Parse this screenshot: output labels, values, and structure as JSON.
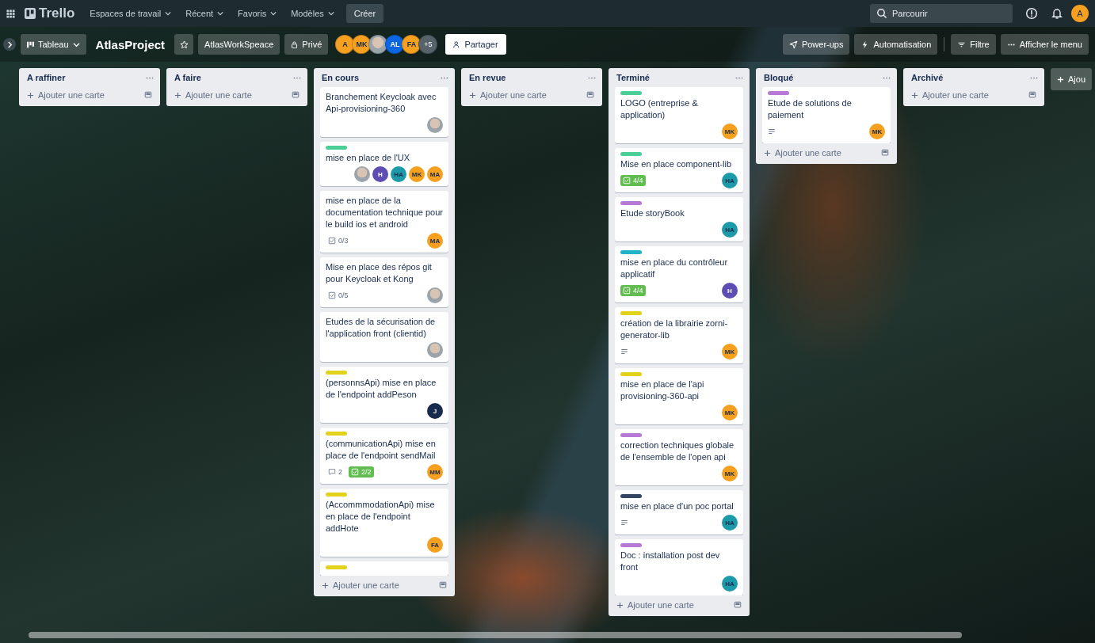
{
  "top_bar": {
    "logo": "Trello",
    "nav_items": [
      {
        "label": "Espaces de travail"
      },
      {
        "label": "Récent"
      },
      {
        "label": "Favoris"
      },
      {
        "label": "Modèles"
      }
    ],
    "create_button": "Créer",
    "search": {
      "placeholder": "Parcourir"
    },
    "user_avatar": {
      "initials": "A",
      "color": "#f6a020"
    }
  },
  "board_header": {
    "view_switcher": "Tableau",
    "title": "AtlasProject",
    "workspace": "AtlasWorkSpeace",
    "visibility": "Privé",
    "members": [
      {
        "kind": "initials",
        "initials": "A",
        "color": "#f6a020"
      },
      {
        "kind": "initials",
        "initials": "MK",
        "color": "#f6a020"
      },
      {
        "kind": "photo"
      },
      {
        "kind": "initials",
        "initials": "AL",
        "color": "#0c66e4"
      },
      {
        "kind": "initials",
        "initials": "FA",
        "color": "#f6a020"
      }
    ],
    "extra_members": "+5",
    "share_button": "Partager",
    "actions": [
      {
        "label": "Power-ups"
      },
      {
        "label": "Automatisation"
      },
      {
        "label": "Filtre"
      },
      {
        "label": "Afficher le menu"
      }
    ]
  },
  "lists": [
    {
      "title": "A raffiner",
      "add_card": "Ajouter une carte"
    },
    {
      "title": "A faire",
      "add_card": "Ajouter une carte"
    },
    {
      "title": "En cours",
      "add_card": "Ajouter une carte",
      "cards": [
        {
          "title": "Branchement Keycloak avec Api-provisioning-360",
          "members": [
            {
              "kind": "photo"
            }
          ]
        },
        {
          "labels": [
            {
              "color": "#4bce97"
            }
          ],
          "title": "mise en place de l'UX",
          "members": [
            {
              "kind": "photo"
            },
            {
              "kind": "initials",
              "initials": "H",
              "color": "#5e4db2"
            },
            {
              "kind": "initials",
              "initials": "HA",
              "color": "#1d9aaa"
            },
            {
              "kind": "initials",
              "initials": "MK",
              "color": "#f6a020"
            },
            {
              "kind": "initials",
              "initials": "MA",
              "color": "#f6a020"
            }
          ]
        },
        {
          "title": "mise en place de la documentation technique pour le build ios et android",
          "badges": [
            {
              "kind": "checklist",
              "text": "0/3",
              "complete": false
            }
          ],
          "members": [
            {
              "kind": "initials",
              "initials": "MA",
              "color": "#f6a020"
            }
          ]
        },
        {
          "title": "Mise en place des répos git pour Keycloak et Kong",
          "badges": [
            {
              "kind": "checklist",
              "text": "0/5",
              "complete": false
            }
          ],
          "members": [
            {
              "kind": "photo"
            }
          ]
        },
        {
          "title": "Etudes de la sécurisation de l'application front (clientid)",
          "members": [
            {
              "kind": "photo"
            }
          ]
        },
        {
          "labels": [
            {
              "color": "#e2d21a"
            }
          ],
          "title": "(personnsApi) mise en place de l'endpoint addPeson",
          "members": [
            {
              "kind": "initials",
              "initials": "J",
              "color": "#172b4d"
            }
          ]
        },
        {
          "labels": [
            {
              "color": "#e2d21a"
            }
          ],
          "title": "(communicationApi) mise en place de l'endpoint sendMail",
          "badges": [
            {
              "kind": "comments",
              "text": "2"
            },
            {
              "kind": "checklist",
              "text": "2/2",
              "complete": true
            }
          ],
          "members": [
            {
              "kind": "initials",
              "initials": "MM",
              "color": "#f6a020"
            }
          ]
        },
        {
          "labels": [
            {
              "color": "#e2d21a"
            }
          ],
          "title": "(AccommmodationApi) mise en place de l'endpoint addHote",
          "members": [
            {
              "kind": "initials",
              "initials": "FA",
              "color": "#f6a020"
            }
          ]
        },
        {
          "labels": [
            {
              "color": "#e2d21a"
            }
          ]
        }
      ]
    },
    {
      "title": "En revue",
      "add_card": "Ajouter une carte"
    },
    {
      "title": "Terminé",
      "add_card": "Ajouter une carte",
      "cards": [
        {
          "labels": [
            {
              "color": "#4bce97"
            }
          ],
          "title": "LOGO (entreprise & application)",
          "members": [
            {
              "kind": "initials",
              "initials": "MK",
              "color": "#f6a020"
            }
          ]
        },
        {
          "labels": [
            {
              "color": "#4bce97"
            }
          ],
          "title": "Mise en place component-lib",
          "badges": [
            {
              "kind": "checklist",
              "text": "4/4",
              "complete": true
            }
          ],
          "members": [
            {
              "kind": "initials",
              "initials": "HA",
              "color": "#1d9aaa"
            }
          ]
        },
        {
          "labels": [
            {
              "color": "#b67ad6"
            }
          ],
          "title": "Etude storyBook",
          "members": [
            {
              "kind": "initials",
              "initials": "HA",
              "color": "#1d9aaa"
            }
          ]
        },
        {
          "labels": [
            {
              "color": "#1fb3c8"
            }
          ],
          "title": "mise en place du contrôleur applicatif",
          "badges": [
            {
              "kind": "checklist",
              "text": "4/4",
              "complete": true
            }
          ],
          "members": [
            {
              "kind": "initials",
              "initials": "H",
              "color": "#5e4db2"
            }
          ]
        },
        {
          "labels": [
            {
              "color": "#e2d21a"
            }
          ],
          "title": "création de la librairie zorni-generator-lib",
          "badges": [
            {
              "kind": "description"
            }
          ],
          "members": [
            {
              "kind": "initials",
              "initials": "MK",
              "color": "#f6a020"
            }
          ]
        },
        {
          "labels": [
            {
              "color": "#e2d21a"
            }
          ],
          "title": "mise en place de l'api provisioning-360-api",
          "members": [
            {
              "kind": "initials",
              "initials": "MK",
              "color": "#f6a020"
            }
          ]
        },
        {
          "labels": [
            {
              "color": "#b67ad6"
            }
          ],
          "title": "correction techniques globale de l'ensemble de l'open api",
          "members": [
            {
              "kind": "initials",
              "initials": "MK",
              "color": "#f6a020"
            }
          ]
        },
        {
          "labels": [
            {
              "color": "#344563"
            }
          ],
          "title": "mise en place d'un poc portal",
          "badges": [
            {
              "kind": "description"
            }
          ],
          "members": [
            {
              "kind": "initials",
              "initials": "HA",
              "color": "#1d9aaa"
            }
          ]
        },
        {
          "labels": [
            {
              "color": "#b67ad6"
            }
          ],
          "title": "Doc : installation post dev front",
          "members": [
            {
              "kind": "initials",
              "initials": "HA",
              "color": "#1d9aaa"
            }
          ]
        }
      ]
    },
    {
      "title": "Bloqué",
      "add_card": "Ajouter une carte",
      "cards": [
        {
          "labels": [
            {
              "color": "#b67ad6"
            }
          ],
          "title": "Etude de solutions de paiement",
          "badges": [
            {
              "kind": "description"
            }
          ],
          "members": [
            {
              "kind": "initials",
              "initials": "MK",
              "color": "#f6a020"
            }
          ]
        }
      ]
    },
    {
      "title": "Archivé",
      "add_card": "Ajouter une carte"
    }
  ],
  "add_list": "Ajou"
}
